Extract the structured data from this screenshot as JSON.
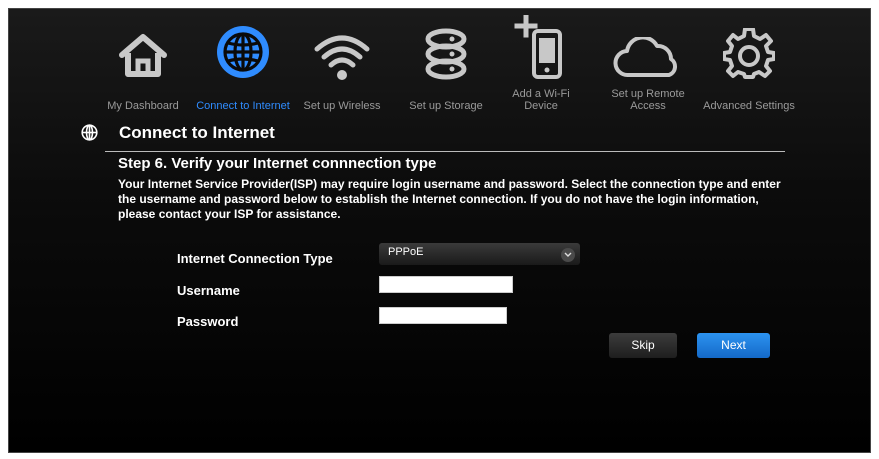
{
  "nav": {
    "items": [
      {
        "label_lines": [
          "My Dashboard"
        ],
        "icon": "home-icon",
        "active": false
      },
      {
        "label_lines": [
          "Connect to Internet"
        ],
        "icon": "globe-icon",
        "active": true
      },
      {
        "label_lines": [
          "Set up Wireless"
        ],
        "icon": "wifi-icon",
        "active": false
      },
      {
        "label_lines": [
          "Set up Storage"
        ],
        "icon": "storage-icon",
        "active": false
      },
      {
        "label_lines": [
          "Add a Wi-Fi",
          "Device"
        ],
        "icon": "add-device-icon",
        "active": false
      },
      {
        "label_lines": [
          "Set up Remote",
          "Access"
        ],
        "icon": "cloud-icon",
        "active": false
      },
      {
        "label_lines": [
          "Advanced Settings"
        ],
        "icon": "gear-icon",
        "active": false
      }
    ]
  },
  "section": {
    "title": "Connect to Internet",
    "icon": "globe-icon"
  },
  "step": {
    "title": "Step 6. Verify your Internet connnection type",
    "description": "Your Internet Service Provider(ISP) may require login username and password. Select the connection type and enter the username and password below to establish the Internet connection. If you do not have the login information, please contact your ISP for assistance."
  },
  "form": {
    "connection_type_label": "Internet Connection Type",
    "connection_type_value": "PPPoE",
    "username_label": "Username",
    "username_value": "",
    "password_label": "Password",
    "password_value": ""
  },
  "buttons": {
    "skip": "Skip",
    "next": "Next"
  },
  "colors": {
    "accent": "#2f8cff",
    "inactive_icon": "#c8c8c8",
    "background": "#000000"
  }
}
